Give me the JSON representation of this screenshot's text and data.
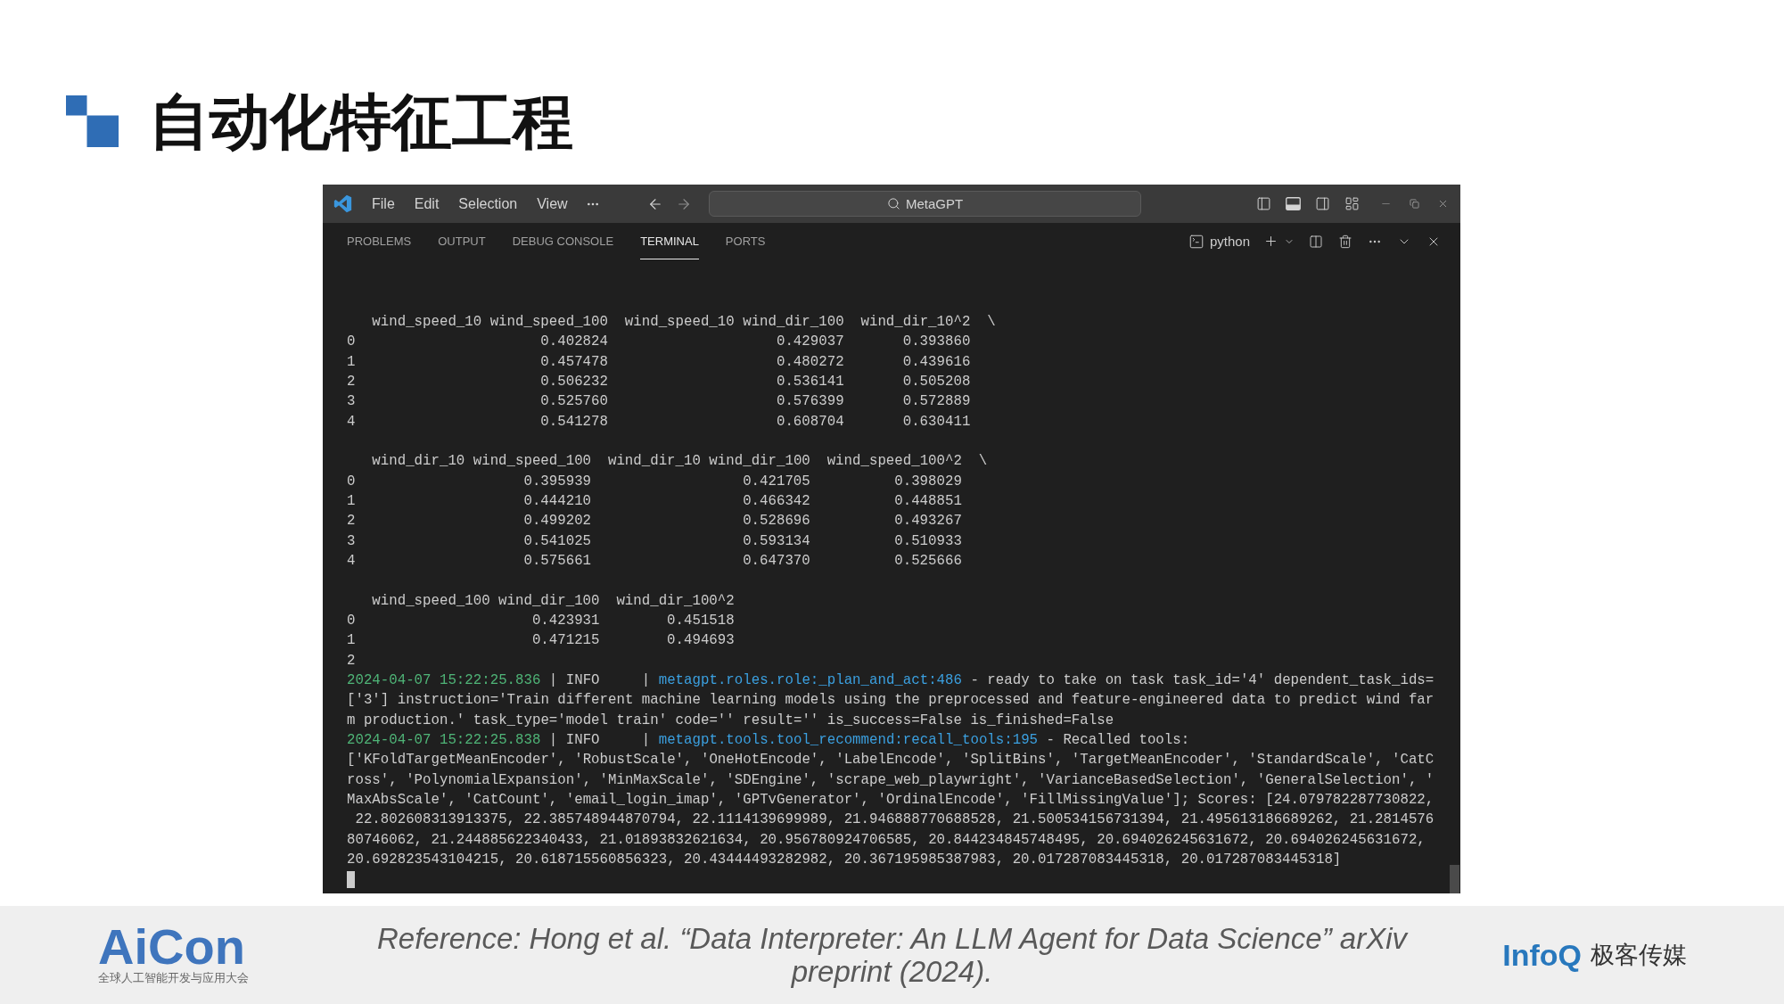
{
  "slide_title": "自动化特征工程",
  "editor": {
    "menu": [
      "File",
      "Edit",
      "Selection",
      "View"
    ],
    "command_center": "MetaGPT",
    "panel_tabs": [
      {
        "label": "PROBLEMS",
        "selected": false
      },
      {
        "label": "OUTPUT",
        "selected": false
      },
      {
        "label": "DEBUG CONSOLE",
        "selected": false
      },
      {
        "label": "TERMINAL",
        "selected": true
      },
      {
        "label": "PORTS",
        "selected": false
      }
    ],
    "terminal_profile": "python",
    "terminal": {
      "tables": [
        {
          "columns": [
            "wind_speed_10 wind_speed_100",
            "wind_speed_10 wind_dir_100",
            "wind_dir_10^2"
          ],
          "continuation": "\\",
          "rows": [
            {
              "index": "0",
              "values": [
                "0.402824",
                "0.429037",
                "0.393860"
              ]
            },
            {
              "index": "1",
              "values": [
                "0.457478",
                "0.480272",
                "0.439616"
              ]
            },
            {
              "index": "2",
              "values": [
                "0.506232",
                "0.536141",
                "0.505208"
              ]
            },
            {
              "index": "3",
              "values": [
                "0.525760",
                "0.576399",
                "0.572889"
              ]
            },
            {
              "index": "4",
              "values": [
                "0.541278",
                "0.608704",
                "0.630411"
              ]
            }
          ]
        },
        {
          "columns": [
            "wind_dir_10 wind_speed_100",
            "wind_dir_10 wind_dir_100",
            "wind_speed_100^2"
          ],
          "continuation": "\\",
          "rows": [
            {
              "index": "0",
              "values": [
                "0.395939",
                "0.421705",
                "0.398029"
              ]
            },
            {
              "index": "1",
              "values": [
                "0.444210",
                "0.466342",
                "0.448851"
              ]
            },
            {
              "index": "2",
              "values": [
                "0.499202",
                "0.528696",
                "0.493267"
              ]
            },
            {
              "index": "3",
              "values": [
                "0.541025",
                "0.593134",
                "0.510933"
              ]
            },
            {
              "index": "4",
              "values": [
                "0.575661",
                "0.647370",
                "0.525666"
              ]
            }
          ]
        },
        {
          "columns": [
            "wind_speed_100 wind_dir_100",
            "wind_dir_100^2"
          ],
          "rows": [
            {
              "index": "0",
              "values": [
                "0.423931",
                "0.451518"
              ]
            },
            {
              "index": "1",
              "values": [
                "0.471215",
                "0.494693"
              ]
            },
            {
              "index": "2"
            }
          ]
        }
      ],
      "log": [
        [
          {
            "kind": "time",
            "text": "2024-04-07 15:22:25.836"
          },
          {
            "kind": "plain",
            "text": " | INFO     | "
          },
          {
            "kind": "source",
            "text": "metagpt.roles.role:_plan_and_act:486"
          },
          {
            "kind": "plain",
            "text": " - ready to take on task task_id='4' dependent_task_ids="
          }
        ],
        [
          {
            "kind": "plain",
            "text": "['3'] instruction='Train different machine learning models using the preprocessed and feature-engineered data to predict wind far"
          }
        ],
        [
          {
            "kind": "plain",
            "text": "m production.' task_type='model train' code='' result='' is_success=False is_finished=False"
          }
        ],
        [
          {
            "kind": "time",
            "text": "2024-04-07 15:22:25.838"
          },
          {
            "kind": "plain",
            "text": " | INFO     | "
          },
          {
            "kind": "source",
            "text": "metagpt.tools.tool_recommend:recall_tools:195"
          },
          {
            "kind": "plain",
            "text": " - Recalled tools:"
          }
        ],
        [
          {
            "kind": "plain",
            "text": "['KFoldTargetMeanEncoder', 'RobustScale', 'OneHotEncode', 'LabelEncode', 'SplitBins', 'TargetMeanEncoder', 'StandardScale', 'CatC"
          }
        ],
        [
          {
            "kind": "plain",
            "text": "ross', 'PolynomialExpansion', 'MinMaxScale', 'SDEngine', 'scrape_web_playwright', 'VarianceBasedSelection', 'GeneralSelection', '"
          }
        ],
        [
          {
            "kind": "plain",
            "text": "MaxAbsScale', 'CatCount', 'email_login_imap', 'GPTvGenerator', 'OrdinalEncode', 'FillMissingValue']; Scores: [24.079782287730822,"
          }
        ],
        [
          {
            "kind": "plain",
            "text": " 22.802608313913375, 22.385748944870794, 22.1114139699989, 21.946888770688528, 21.500534156731394, 21.495613186689262, 21.2814576"
          }
        ],
        [
          {
            "kind": "plain",
            "text": "80746062, 21.244885622340433, 21.01893832621634, 20.956780924706585, 20.844234845748495, 20.694026245631672, 20.694026245631672,"
          }
        ],
        [
          {
            "kind": "plain",
            "text": "20.692823543104215, 20.618715560856323, 20.43444493282982, 20.367195985387983, 20.017287083445318, 20.017287083445318]"
          }
        ]
      ]
    }
  },
  "footer": {
    "logo": {
      "wordmark": "AiCon",
      "tagline": "全球人工智能开发与应用大会"
    },
    "reference": "Reference: Hong et al. “Data Interpreter: An LLM Agent for Data Science” arXiv preprint (2024).",
    "publisher": {
      "wordmark": "InfoQ",
      "name": "极客传媒"
    }
  }
}
